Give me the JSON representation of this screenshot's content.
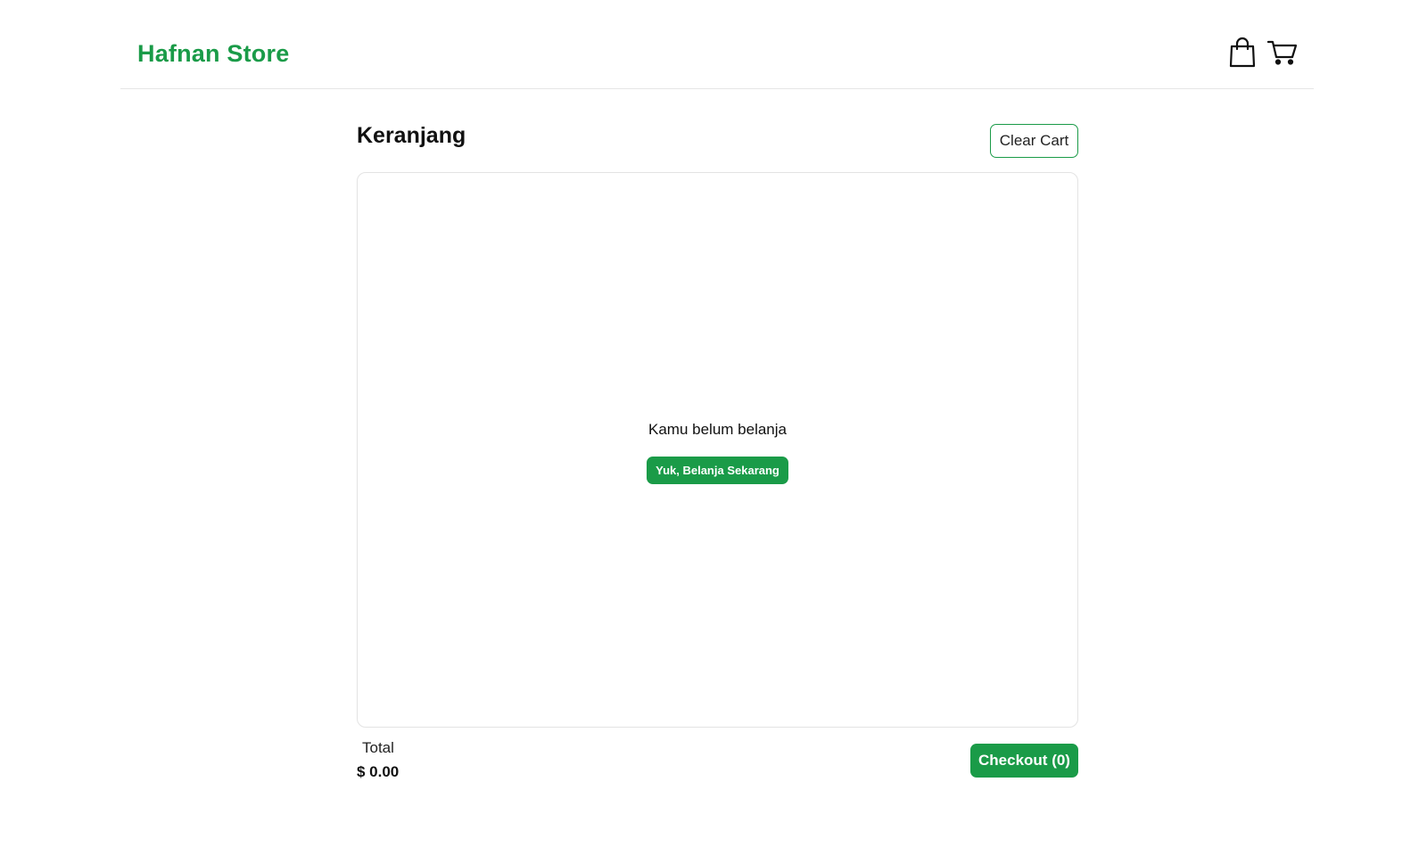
{
  "navbar": {
    "brand": "Hafnan Store",
    "icons": [
      "shopping-bag-icon",
      "shopping-cart-icon"
    ]
  },
  "cart": {
    "title": "Keranjang",
    "clear_label": "Clear Cart",
    "empty_message": "Kamu belum belanja",
    "shop_now_label": "Yuk, Belanja Sekarang",
    "total_label": "Total",
    "total_value": "$ 0.00",
    "checkout_label": "Checkout (0)"
  },
  "colors": {
    "brand": "#1a9b48",
    "border": "#e3e3e3",
    "text": "#111111"
  }
}
